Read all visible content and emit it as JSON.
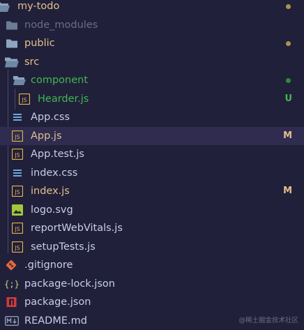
{
  "colors": {
    "background": "#21203a",
    "selected_row": "#2f2c50",
    "modified": "#e2c08d",
    "untracked": "#3fb950",
    "ignored": "#6e6c88",
    "default_text": "#c9cde8",
    "folder_icon": "#8fa6c0",
    "js_icon": "#e6b450",
    "css_icon": "#6fa8dc",
    "svg_icon": "#a4c639",
    "git_icon": "#e0683c",
    "npm_icon": "#d33a3a",
    "json_icon": "#c6d08a",
    "readme_icon": "#8f9bb3"
  },
  "items": [
    {
      "label": "my-todo",
      "icon": "folder-open-icon",
      "status_dot": "modified"
    },
    {
      "label": "node_modules",
      "icon": "folder-icon"
    },
    {
      "label": "public",
      "icon": "folder-icon",
      "status_dot": "modified"
    },
    {
      "label": "src",
      "icon": "folder-open-icon"
    },
    {
      "label": "component",
      "icon": "folder-open-icon",
      "status_dot": "untracked"
    },
    {
      "label": "Hearder.js",
      "icon": "js-file-icon",
      "status": "U"
    },
    {
      "label": "App.css",
      "icon": "css-file-icon"
    },
    {
      "label": "App.js",
      "icon": "js-file-icon",
      "status": "M",
      "selected": true
    },
    {
      "label": "App.test.js",
      "icon": "js-file-icon"
    },
    {
      "label": "index.css",
      "icon": "css-file-icon"
    },
    {
      "label": "index.js",
      "icon": "js-file-icon",
      "status": "M"
    },
    {
      "label": "logo.svg",
      "icon": "image-file-icon"
    },
    {
      "label": "reportWebVitals.js",
      "icon": "js-file-icon"
    },
    {
      "label": "setupTests.js",
      "icon": "js-file-icon"
    },
    {
      "label": ".gitignore",
      "icon": "git-icon"
    },
    {
      "label": "package-lock.json",
      "icon": "json-icon"
    },
    {
      "label": "package.json",
      "icon": "npm-icon"
    },
    {
      "label": "README.md",
      "icon": "readme-icon"
    }
  ],
  "watermark": "@稀土掘金技术社区"
}
